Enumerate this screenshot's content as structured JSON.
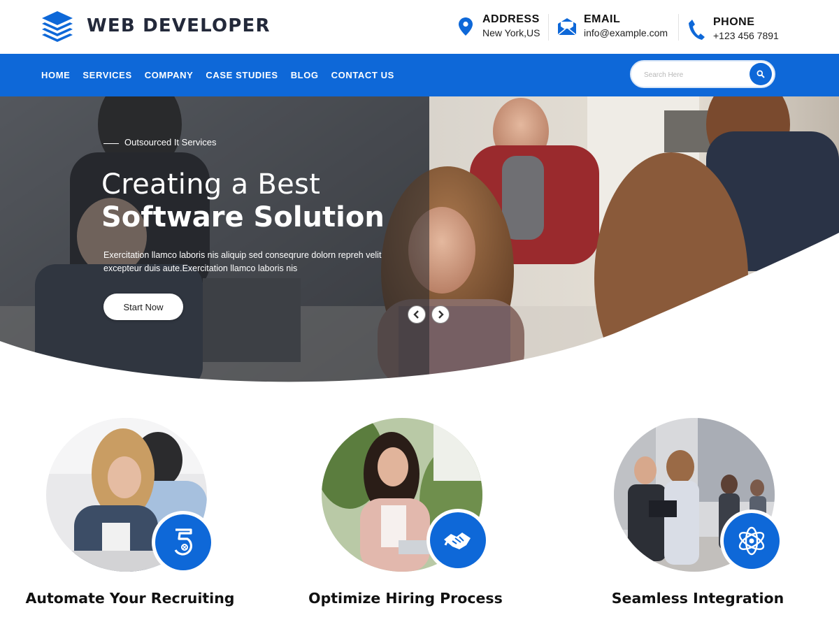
{
  "brand": {
    "name": "WEB DEVELOPER",
    "accent_color": "#0e68d8",
    "dark_text_color": "#23293a"
  },
  "contact": {
    "address": {
      "icon": "map-pin-icon",
      "label": "ADDRESS",
      "value": "New York,US"
    },
    "email": {
      "icon": "envelope-icon",
      "label": "EMAIL",
      "value": "info@example.com"
    },
    "phone": {
      "icon": "phone-icon",
      "label": "PHONE",
      "value": "+123 456 7891"
    }
  },
  "nav": {
    "items": [
      {
        "label": "HOME"
      },
      {
        "label": "SERVICES"
      },
      {
        "label": "COMPANY"
      },
      {
        "label": "CASE STUDIES"
      },
      {
        "label": "BLOG"
      },
      {
        "label": "CONTACT US"
      }
    ],
    "search": {
      "placeholder": "Search Here",
      "icon": "search-icon"
    }
  },
  "hero": {
    "eyebrow": "Outsourced It Services",
    "title_line1": "Creating a Best",
    "title_line2": "Software Solution",
    "description": "Exercitation llamco laboris nis aliquip sed conseqrure dolorn repreh velit excepteur duis aute.Exercitation llamco laboris nis",
    "cta_label": "Start Now",
    "prev_icon": "chevron-left-icon",
    "next_icon": "chevron-right-icon"
  },
  "features": [
    {
      "title": "Automate Your Recruiting",
      "icon": "html5-icon"
    },
    {
      "title": "Optimize Hiring Process",
      "icon": "handshake-icon"
    },
    {
      "title": "Seamless Integration",
      "icon": "atom-icon"
    }
  ]
}
